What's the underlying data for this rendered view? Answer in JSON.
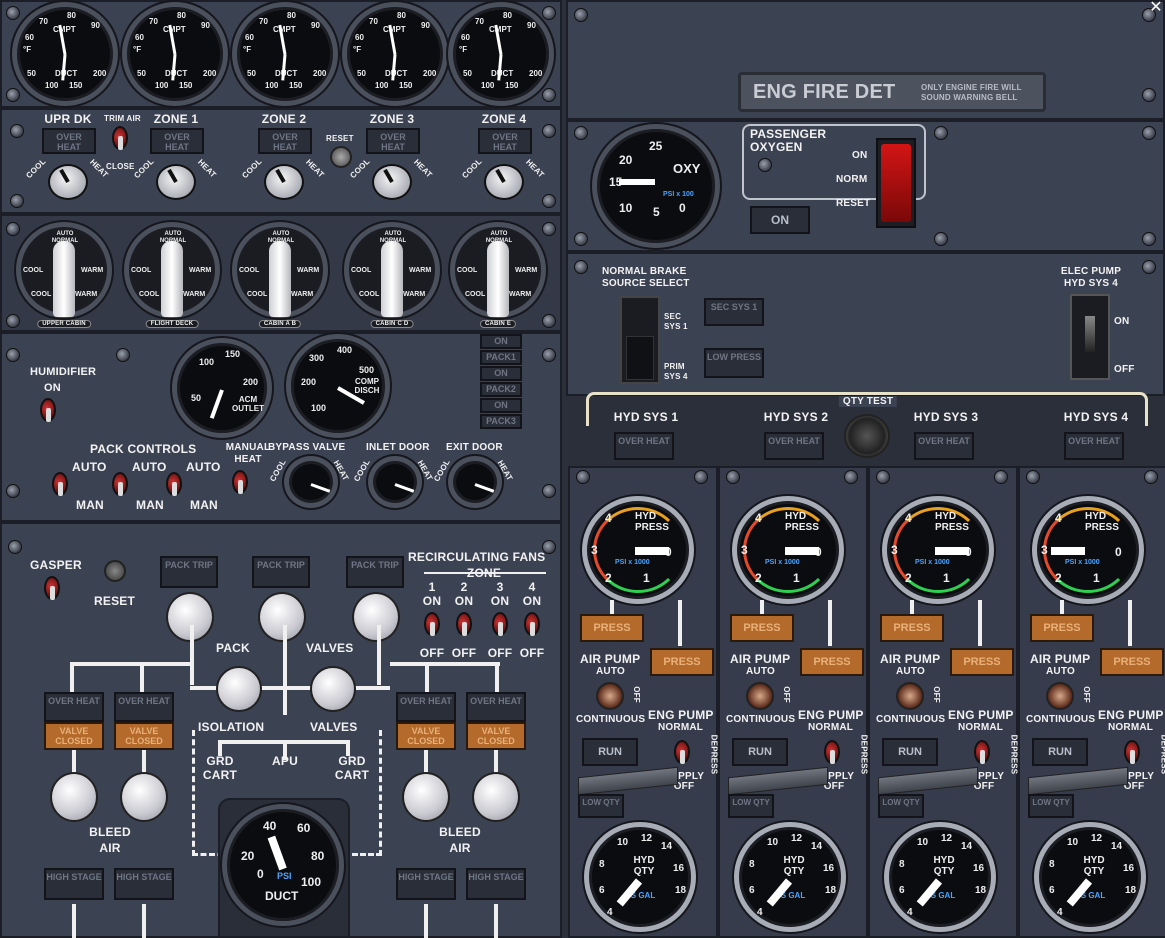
{
  "top_left": {
    "temp_gauge": {
      "cmpt_label": "CMPT",
      "duct_label": "DUCT",
      "unit": "°F",
      "scale": [
        "60",
        "70",
        "80",
        "90",
        "50",
        "100",
        "150",
        "200"
      ]
    },
    "zones": [
      "UPR DK",
      "ZONE 1",
      "ZONE 2",
      "ZONE 3",
      "ZONE 4"
    ],
    "over_heat": "OVER HEAT",
    "trim_air": "TRIM AIR",
    "close": "CLOSE",
    "reset": "RESET",
    "cool": "COOL",
    "heat": "HEAT",
    "selector_auto": "AUTO NORMAL",
    "selector_cool": "COOL",
    "selector_warm": "WARM",
    "selector_plates": [
      "UPPER CABIN",
      "FLIGHT DECK",
      "CABIN A B",
      "CABIN C D",
      "CABIN E"
    ]
  },
  "pack_panel": {
    "humidifier": "HUMIDIFIER",
    "on": "ON",
    "acm_outlet": "ACM OUTLET",
    "acm_scale": [
      "50",
      "100",
      "150",
      "200"
    ],
    "comp_disch": "COMP DISCH",
    "comp_scale": [
      "100",
      "200",
      "300",
      "400",
      "500"
    ],
    "pack_lights": [
      "ON",
      "PACK1",
      "ON",
      "PACK2",
      "ON",
      "PACK3"
    ],
    "pack_controls": "PACK CONTROLS",
    "auto": "AUTO",
    "man": "MAN",
    "manual_heat": "MANUAL HEAT",
    "bypass_valve": "BYPASS VALVE",
    "inlet_door": "INLET DOOR",
    "exit_door": "EXIT DOOR",
    "cool": "COOL",
    "heat": "HEAT"
  },
  "lower_left": {
    "gasper": "GASPER",
    "reset": "RESET",
    "pack_trip": "PACK TRIP",
    "recirc": "RECIRCULATING FANS",
    "zone": "ZONE",
    "fan_numbers": [
      "1",
      "2",
      "3",
      "4"
    ],
    "on": "ON",
    "off": "OFF",
    "pack": "PACK",
    "valves": "VALVES",
    "isolation": "ISOLATION",
    "over_heat": "OVER HEAT",
    "valve_closed": "VALVE CLOSED",
    "grd_cart": "GRD CART",
    "apu": "APU",
    "bleed_air": "BLEED AIR",
    "high_stage": "HIGH STAGE",
    "duct_gauge": {
      "label": "DUCT",
      "unit": "PSI",
      "scale": [
        "20",
        "40",
        "60",
        "80",
        "100",
        "0"
      ]
    }
  },
  "right_top": {
    "close_icon": "close-icon",
    "eng_fire_det": "ENG FIRE DET",
    "eng_fire_note": "ONLY ENGINE FIRE WILL SOUND WARNING BELL",
    "oxy_label": "OXY",
    "oxy_unit": "PSI x 100",
    "oxy_scale": [
      "25",
      "20",
      "15",
      "10",
      "5",
      "0"
    ],
    "passenger_oxygen": "PASSENGER OXYGEN",
    "on_btn": "ON",
    "switch_on": "ON",
    "switch_norm": "NORM",
    "switch_reset": "RESET"
  },
  "brake": {
    "normal_brake": "NORMAL BRAKE SOURCE SELECT",
    "sec_sys1": "SEC SYS 1",
    "prim_sys4": "PRIM SYS 4",
    "sec_sys1_btn": "SEC SYS 1",
    "low_press": "LOW PRESS",
    "elec_pump": "ELEC PUMP HYD SYS 4",
    "on": "ON",
    "off": "OFF"
  },
  "hyd": {
    "qty_test": "QTY TEST",
    "systems": [
      "HYD SYS 1",
      "HYD SYS 2",
      "HYD SYS 3",
      "HYD SYS 4"
    ],
    "over_heat": "OVER HEAT",
    "press_gauge": {
      "label": "HYD PRESS",
      "unit": "PSI x 1000",
      "scale": [
        "4",
        "3",
        "2",
        "1",
        "0"
      ]
    },
    "press": "PRESS",
    "air_pump": "AIR PUMP",
    "auto": "AUTO",
    "off": "OFF",
    "continuous": "CONTINUOUS",
    "eng_pump": "ENG PUMP",
    "normal": "NORMAL",
    "depress": "DEPRESS",
    "supply_off": "SUPPLY OFF",
    "run": "RUN",
    "low_qty": "LOW QTY",
    "qty_gauge": {
      "label": "HYD QTY",
      "unit": "US GAL",
      "scale": [
        "8",
        "10",
        "12",
        "14",
        "16",
        "18",
        "6",
        "4"
      ]
    }
  }
}
